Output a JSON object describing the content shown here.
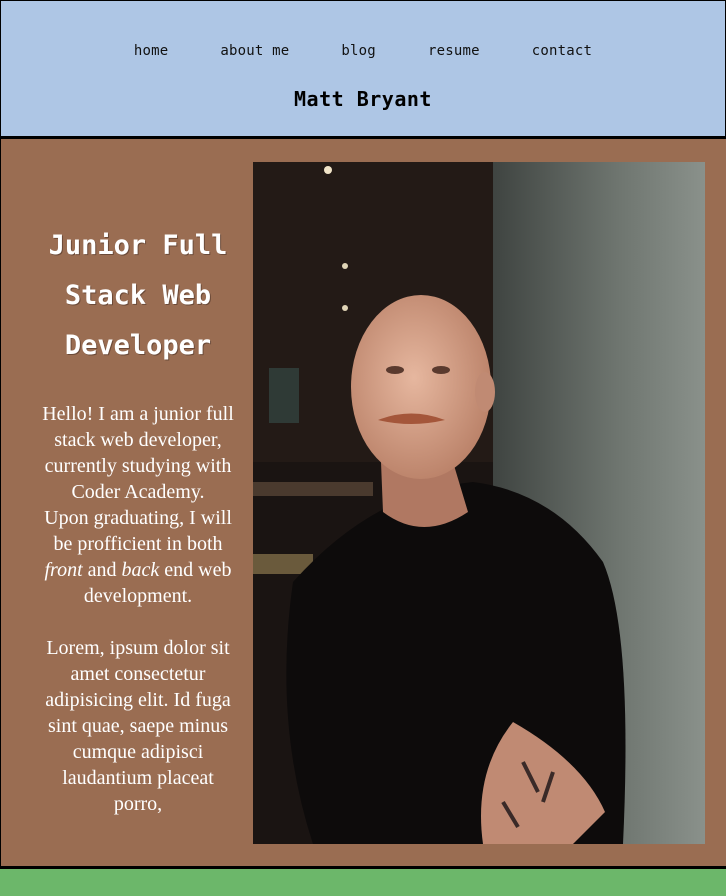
{
  "nav": {
    "items": [
      {
        "label": "home"
      },
      {
        "label": "about me"
      },
      {
        "label": "blog"
      },
      {
        "label": "resume"
      },
      {
        "label": "contact"
      }
    ]
  },
  "header": {
    "site_title": "Matt Bryant"
  },
  "intro": {
    "role_title": "Junior Full Stack Web Developer",
    "bio_part1": "Hello! I am a junior full stack web developer, currently studying with Coder Academy.",
    "bio_part2": "Upon graduating, I will be profficient in both",
    "bio_front": "front",
    "bio_and": "and",
    "bio_back": "back",
    "bio_part3": "end web development.",
    "lorem": "Lorem, ipsum dolor sit amet consectetur adipisicing elit. Id fuga sint quae, saepe minus cumque adipisci laudantium placeat porro,"
  },
  "colors": {
    "header_bg": "#aec6e5",
    "main_bg": "#9a6d52",
    "footer_bg": "#6cb76a"
  },
  "icons": {
    "portrait": "portrait-photo"
  }
}
